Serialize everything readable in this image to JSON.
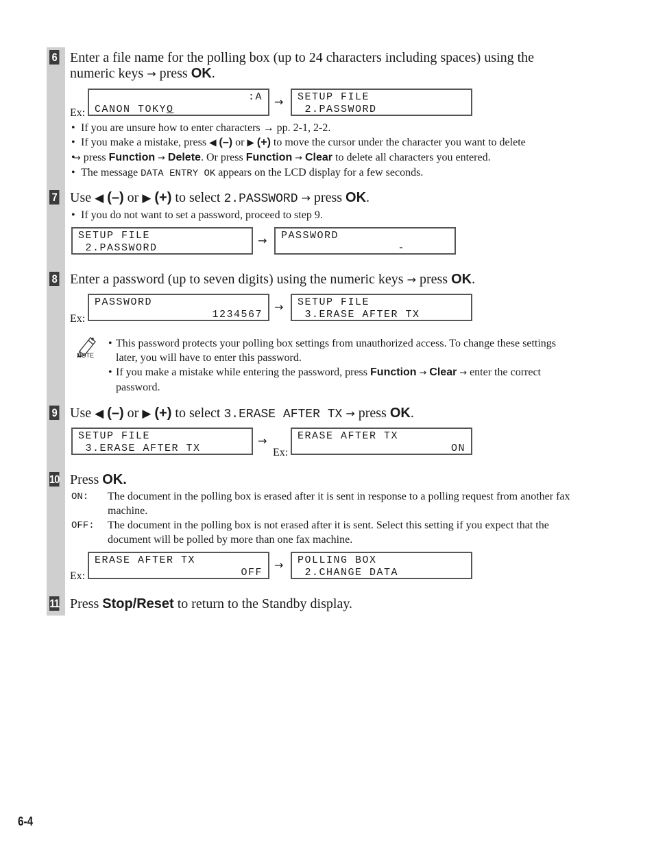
{
  "page_number": "6-4",
  "ex_label": "Ex:",
  "arrow": "→",
  "left_key": "◀",
  "right_key": "▶",
  "minus": "(–)",
  "plus": "(+)",
  "steps": {
    "s6": {
      "number": "6",
      "line1": "Enter a file name for the polling box (up to 24 characters including spaces) using the",
      "line2_pre": "numeric keys",
      "line2_mid": "press",
      "ok": "OK",
      "period": ".",
      "lcd_a": {
        "line1": ":A",
        "line2_pre": "CANON TOKY",
        "line2_cursor": "O"
      },
      "lcd_b": {
        "line1": "SETUP FILE",
        "line2": " 2.PASSWORD"
      },
      "bullets": {
        "b1": "If you are unsure how to enter characters → pp. 2-1, 2-2.",
        "b2_pre": "If you make a mistake, press",
        "b2_or": "or",
        "b2_post": "to move the cursor under the character you want to delete",
        "b2_line2_press": "press",
        "function": "Function",
        "delete": "Delete",
        "b2_or_press": ". Or press",
        "clear": "Clear",
        "b2_end": "to delete all characters you entered.",
        "b3_pre": "The message",
        "b3_mono": "DATA ENTRY OK",
        "b3_post": "appears on the LCD display for a few seconds."
      }
    },
    "s7": {
      "number": "7",
      "use": "Use",
      "or": "or",
      "to_select": "to select",
      "item": "2.PASSWORD",
      "press": "press",
      "ok": "OK",
      "bullet": "If you do not want to set a password, proceed to step 9.",
      "lcd_a": {
        "line1": "SETUP FILE",
        "line2": " 2.PASSWORD"
      },
      "lcd_b": {
        "line1": "PASSWORD",
        "line2": "-"
      }
    },
    "s8": {
      "number": "8",
      "text": "Enter a password (up to seven digits) using the numeric keys",
      "press": "press",
      "ok": "OK",
      "lcd_a": {
        "line1": "PASSWORD",
        "line2": "1234567"
      },
      "lcd_b": {
        "line1": "SETUP FILE",
        "line2": " 3.ERASE AFTER TX"
      },
      "note_label": "NOTE",
      "notes": {
        "n1_line1": "This password protects your polling box settings from unauthorized access. To change these settings",
        "n1_line2": "later, you will have to enter this password.",
        "n2_pre": "If you make a mistake while entering the password, press",
        "function": "Function",
        "clear": "Clear",
        "n2_post": "enter the correct",
        "n2_line2": "password."
      }
    },
    "s9": {
      "number": "9",
      "use": "Use",
      "or": "or",
      "to_select": "to select",
      "item": "3.ERASE AFTER TX",
      "press": "press",
      "ok": "OK",
      "lcd_a": {
        "line1": "SETUP FILE",
        "line2": " 3.ERASE AFTER TX"
      },
      "lcd_b": {
        "line1": "ERASE AFTER TX",
        "line2": "ON"
      }
    },
    "s10": {
      "number": "10",
      "press": "Press",
      "ok": "OK.",
      "on_term": "ON:",
      "on_line1": "The document in the polling box is erased after it is sent in response to a polling request from another fax",
      "on_line2": "machine.",
      "off_term": "OFF:",
      "off_line1": "The document in the polling box is not erased after it is sent. Select this setting if you expect that the",
      "off_line2": "document will be polled by more than one fax machine.",
      "lcd_a": {
        "line1": "ERASE AFTER TX",
        "line2": "OFF"
      },
      "lcd_b": {
        "line1": "POLLING BOX",
        "line2": " 2.CHANGE DATA"
      }
    },
    "s11": {
      "number": "11",
      "press": "Press",
      "key": "Stop/Reset",
      "post": "to return to the Standby display."
    }
  }
}
